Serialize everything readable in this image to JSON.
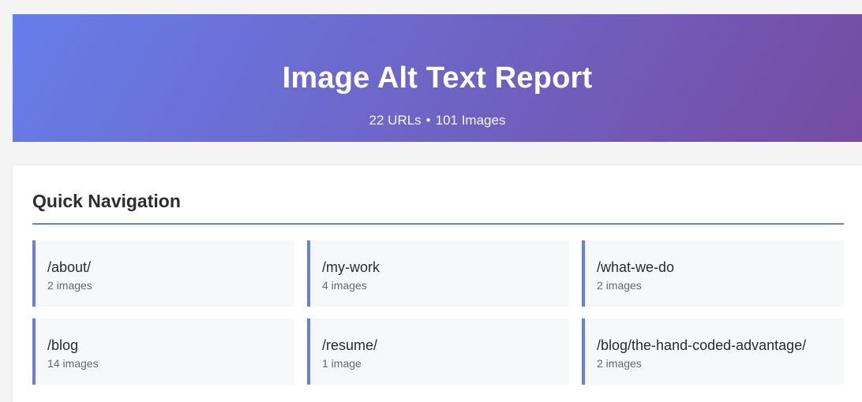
{
  "header": {
    "title": "Image Alt Text Report",
    "url_count": "22 URLs",
    "separator": "•",
    "image_count": "101 Images",
    "gradient_start": "#667eea",
    "gradient_end": "#764ba2"
  },
  "navigation": {
    "heading": "Quick Navigation",
    "accent_color": "#667eea",
    "items": [
      {
        "path": "/about/",
        "count": "2 images"
      },
      {
        "path": "/my-work",
        "count": "4 images"
      },
      {
        "path": "/what-we-do",
        "count": "2 images"
      },
      {
        "path": "/blog",
        "count": "14 images"
      },
      {
        "path": "/resume/",
        "count": "1 image"
      },
      {
        "path": "/blog/the-hand-coded-advantage/",
        "count": "2 images"
      }
    ]
  }
}
